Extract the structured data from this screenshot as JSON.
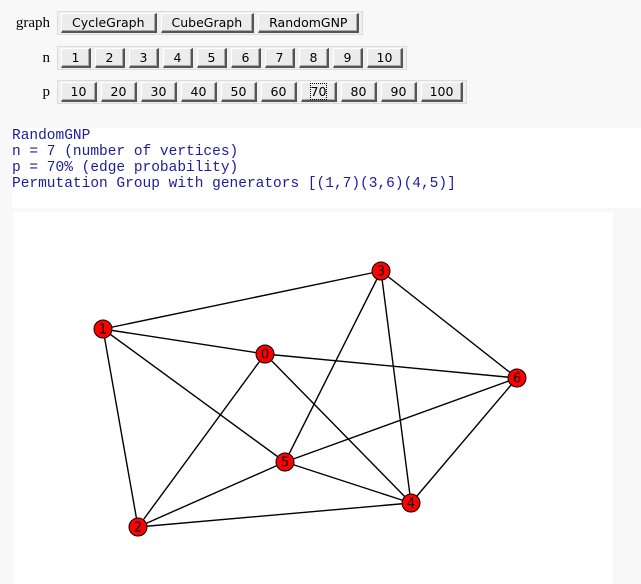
{
  "controls": {
    "graph": {
      "label": "graph",
      "options": [
        "CycleGraph",
        "CubeGraph",
        "RandomGNP"
      ],
      "selected": "RandomGNP"
    },
    "n": {
      "label": "n",
      "options": [
        "1",
        "2",
        "3",
        "4",
        "5",
        "6",
        "7",
        "8",
        "9",
        "10"
      ],
      "selected": "7"
    },
    "p": {
      "label": "p",
      "options": [
        "10",
        "20",
        "30",
        "40",
        "50",
        "60",
        "70",
        "80",
        "90",
        "100"
      ],
      "selected": "70",
      "focused": "70"
    }
  },
  "output": {
    "lines": [
      "RandomGNP",
      "n = 7 (number of vertices)",
      "p = 70% (edge probability)",
      "Permutation Group with generators [(1,7)(3,6)(4,5)]"
    ],
    "color": "#1c1c9e"
  },
  "graph": {
    "node_color": "#ff0000",
    "nodes": [
      {
        "id": "0"
      },
      {
        "id": "1"
      },
      {
        "id": "2"
      },
      {
        "id": "3"
      },
      {
        "id": "4"
      },
      {
        "id": "5"
      },
      {
        "id": "6"
      }
    ],
    "edges": [
      [
        "1",
        "3"
      ],
      [
        "1",
        "0"
      ],
      [
        "1",
        "2"
      ],
      [
        "1",
        "5"
      ],
      [
        "0",
        "6"
      ],
      [
        "0",
        "2"
      ],
      [
        "0",
        "4"
      ],
      [
        "3",
        "5"
      ],
      [
        "3",
        "4"
      ],
      [
        "3",
        "6"
      ],
      [
        "6",
        "5"
      ],
      [
        "6",
        "4"
      ],
      [
        "5",
        "2"
      ],
      [
        "5",
        "4"
      ],
      [
        "2",
        "4"
      ]
    ]
  }
}
